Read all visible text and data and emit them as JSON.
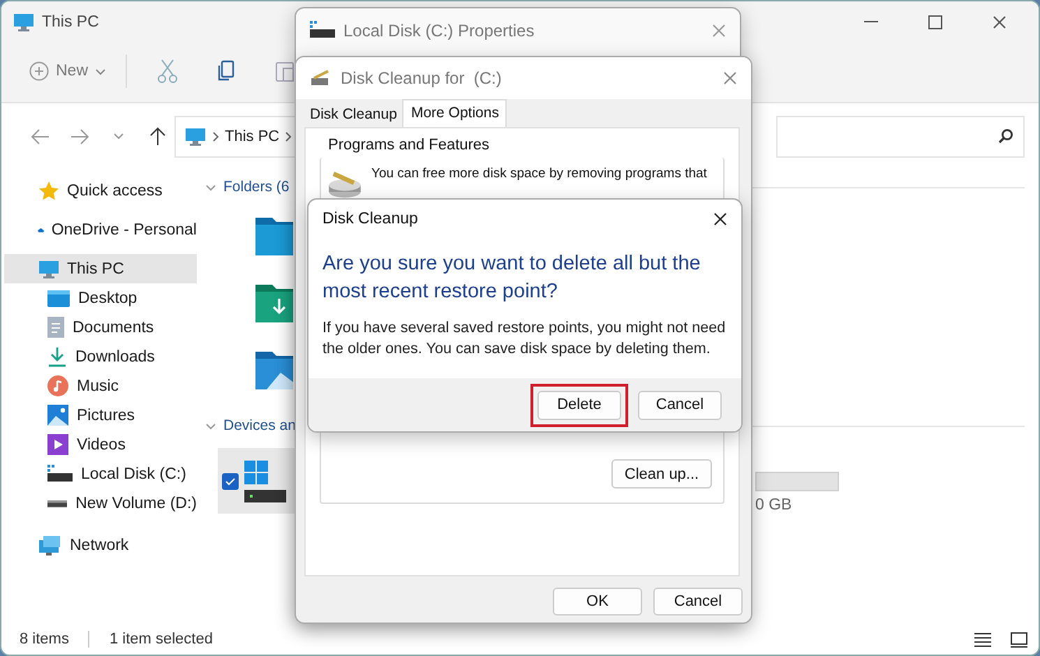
{
  "explorer": {
    "title": "This PC",
    "toolbar": {
      "new_label": "New"
    },
    "address": {
      "path": [
        "This PC"
      ]
    },
    "sidebar": [
      {
        "label": "Quick access",
        "selected": false
      },
      {
        "label": "OneDrive - Personal",
        "selected": false
      },
      {
        "label": "This PC",
        "selected": true,
        "expanded": true,
        "children": [
          {
            "label": "Desktop",
            "selected": false
          },
          {
            "label": "Documents",
            "selected": false
          },
          {
            "label": "Downloads",
            "selected": false
          },
          {
            "label": "Music",
            "selected": false
          },
          {
            "label": "Pictures",
            "selected": false
          },
          {
            "label": "Videos",
            "selected": false
          },
          {
            "label": "Local Disk (C:)",
            "selected": false
          },
          {
            "label": "New Volume (D:)",
            "selected": false
          }
        ]
      },
      {
        "label": "Network",
        "selected": false
      }
    ],
    "content": {
      "folders_heading": "Folders (6",
      "devices_heading": "Devices an",
      "device": {
        "checked": true
      },
      "drive_size": "0 GB"
    },
    "status_bar": {
      "item_count": "8 items",
      "selection": "1 item selected"
    }
  },
  "properties_window": {
    "title": "Local Disk (C:) Properties"
  },
  "cleanup_window": {
    "title": "Disk Cleanup for  (C:)",
    "tabs": [
      {
        "label": "Disk Cleanup",
        "selected": false
      },
      {
        "label": "More Options",
        "selected": true
      }
    ],
    "programs_group": {
      "title": "Programs and Features",
      "description": "You can free more disk space by removing programs that"
    },
    "restore_group": {
      "button": "Clean up..."
    },
    "buttons": [
      "OK",
      "Cancel"
    ]
  },
  "confirm_dialog": {
    "title": "Disk Cleanup",
    "question": "Are you sure you want to delete all but the most recent restore point?",
    "message": "If you have several saved restore points, you might not need the older ones. You can save disk space by deleting them.",
    "buttons": [
      {
        "label": "Delete",
        "highlighted": true
      },
      {
        "label": "Cancel",
        "highlighted": false
      }
    ]
  }
}
